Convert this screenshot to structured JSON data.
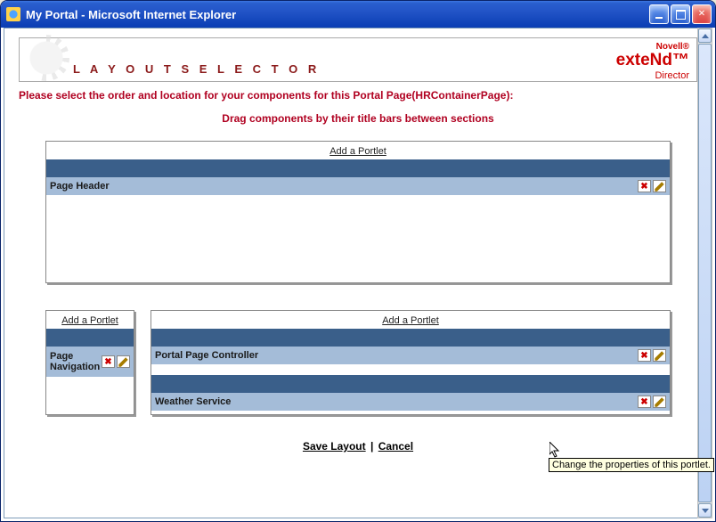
{
  "window": {
    "title": "My Portal - Microsoft Internet Explorer"
  },
  "banner": {
    "title": "L A Y O U T   S E L E C T O R",
    "brand_small": "Novell®",
    "brand_main": "exteNd™",
    "brand_sub": "Director"
  },
  "instruction": "Please select the order and location for your components for this Portal Page(HRContainerPage):",
  "drag_note": "Drag components by their title bars between sections",
  "sections": {
    "top": {
      "add_label": "Add a Portlet",
      "portlets": [
        {
          "title": "Page Header"
        }
      ]
    },
    "left": {
      "add_label": "Add a Portlet",
      "portlets": [
        {
          "title": "Page Navigation"
        }
      ]
    },
    "right": {
      "add_label": "Add a Portlet",
      "portlets": [
        {
          "title": "Portal Page Controller"
        },
        {
          "title": "Weather Service"
        }
      ]
    }
  },
  "actions": {
    "save": "Save Layout",
    "cancel": "Cancel"
  },
  "tooltip": "Change the properties of this portlet."
}
